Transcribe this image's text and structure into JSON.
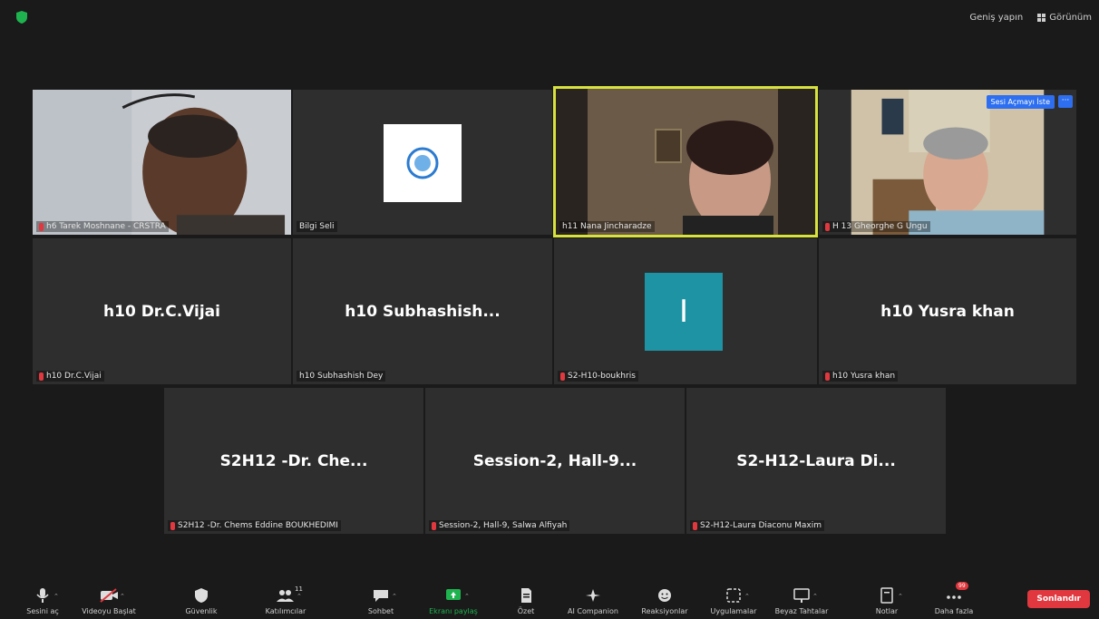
{
  "top_right": {
    "fullscreen_label": "Geniş yapın",
    "view_label": "Görünüm"
  },
  "tiles": {
    "t1": {
      "name": "h6 Tarek Moshnane - CRSTRA"
    },
    "t2": {
      "name": "Bilgi Seli"
    },
    "t3": {
      "name": "h11 Nana Jincharadze"
    },
    "t4": {
      "name": "H 13 Gheorghe G Ungu",
      "pill": "Sesi Açmayı İste",
      "more": "···"
    },
    "t5": {
      "big": "h10 Dr.C.Vijai",
      "name": "h10 Dr.C.Vijai"
    },
    "t6": {
      "big": "h10  Subhashish...",
      "name": "h10 Subhashish Dey"
    },
    "t7": {
      "avatar": "I",
      "name": "S2-H10-boukhris"
    },
    "t8": {
      "big": "h10 Yusra khan",
      "name": "h10 Yusra khan"
    },
    "t9": {
      "big": "S2H12 -Dr. Che...",
      "name": "S2H12 -Dr. Chems Eddine BOUKHEDIMI"
    },
    "t10": {
      "big": "Session-2,  Hall-9...",
      "name": "Session-2, Hall-9, Salwa Alfiyah"
    },
    "t11": {
      "big": "S2-H12-Laura  Di...",
      "name": "S2-H12-Laura Diaconu Maxim"
    }
  },
  "toolbar": {
    "audio": "Sesini aç",
    "video": "Videoyu Başlat",
    "security": "Güvenlik",
    "participants": "Katılımcılar",
    "participants_count": "11",
    "chat": "Sohbet",
    "share": "Ekranı paylaş",
    "summary": "Özet",
    "ai": "AI Companion",
    "reactions": "Reaksiyonlar",
    "apps": "Uygulamalar",
    "whiteboard": "Beyaz Tahtalar",
    "notes": "Notlar",
    "more": "Daha fazla",
    "more_badge": "99",
    "end": "Sonlandır"
  },
  "colors": {
    "active_border": "#d7e23c",
    "end_button": "#e0383e",
    "share_icon": "#1fb34f",
    "accent_blue": "#2d6ff0",
    "avatar_bg": "#1e93a3"
  }
}
